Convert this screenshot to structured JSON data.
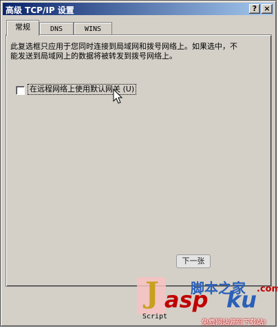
{
  "window": {
    "title": "高级 TCP/IP 设置",
    "help_glyph": "?",
    "close_glyph": "×"
  },
  "tabs": [
    {
      "label": "常规"
    },
    {
      "label": "DNS"
    },
    {
      "label": "WINS"
    }
  ],
  "general": {
    "description": "此复选框只应用于您同时连接到局域网和拨号网络上。如果选中，不能发送到局域网上的数据将被转发到拨号网络上。",
    "checkbox_label": "在远程网络上使用默认网关 (U)",
    "checkbox_checked": false
  },
  "next_button": {
    "label": "下一张"
  },
  "watermark": {
    "j": "J",
    "asp": "asp",
    "ku": "ku",
    "cn": "脚本之家",
    "dotcom": ".com",
    "script": "Script",
    "tagline": "免费网站源码下载站!"
  },
  "colors": {
    "title_bar": "#0a246a",
    "face": "#d4d0c8"
  }
}
